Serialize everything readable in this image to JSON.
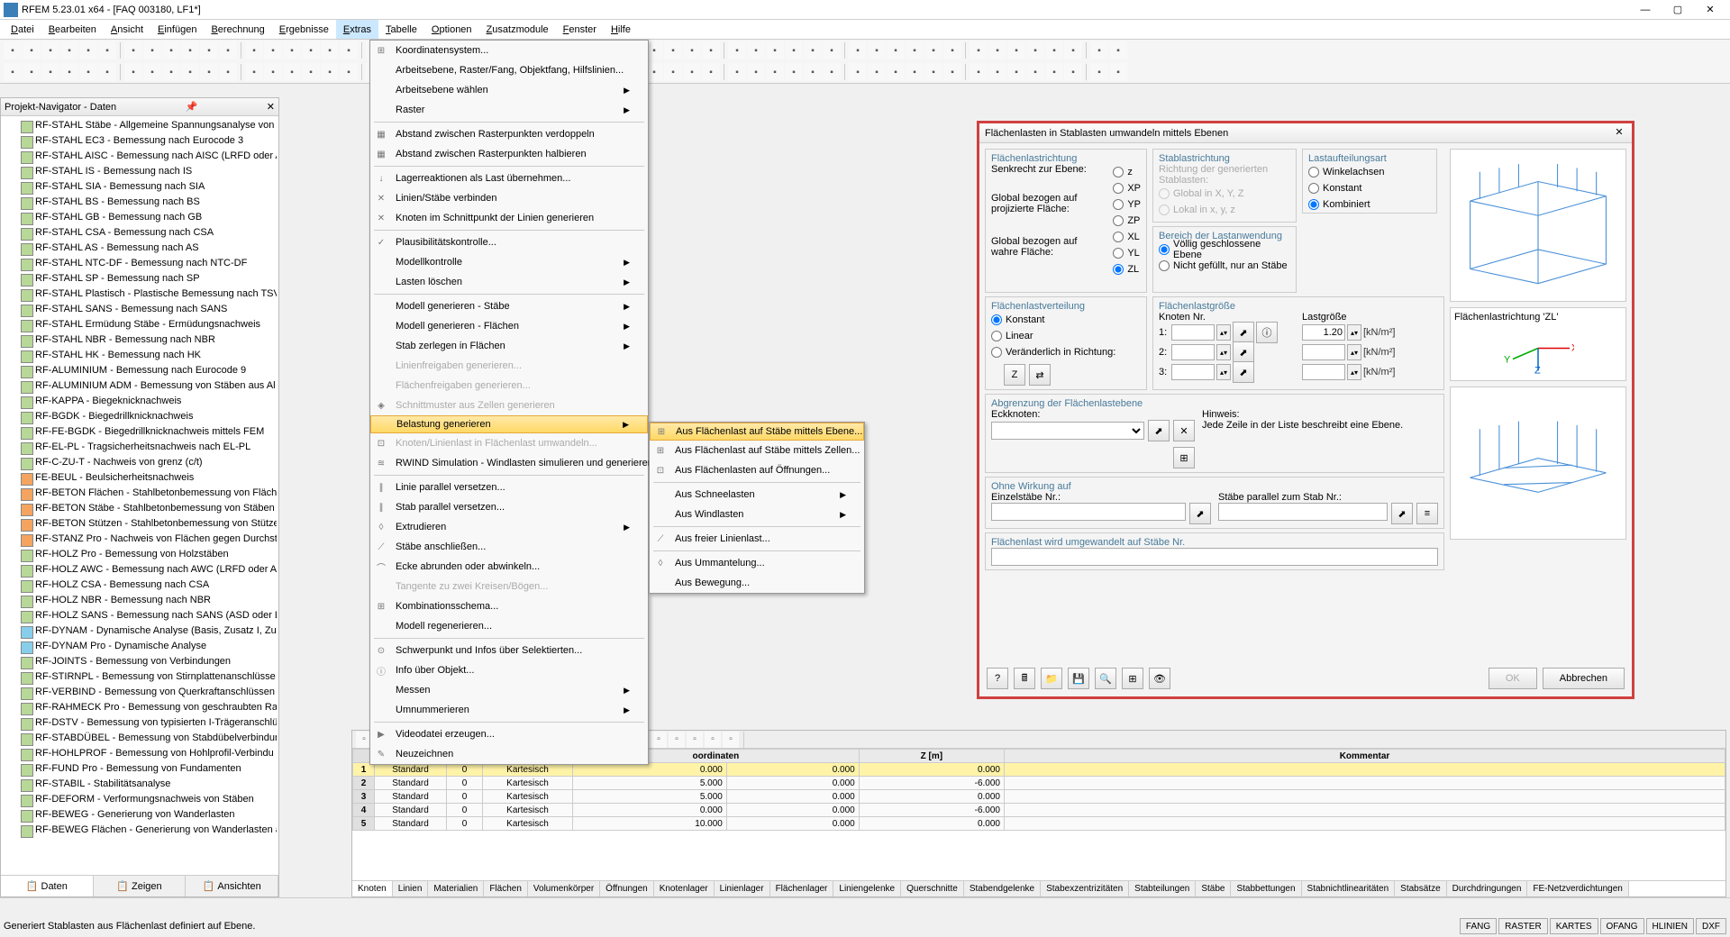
{
  "title": "RFEM 5.23.01 x64 - [FAQ 003180, LF1*]",
  "menubar": [
    "Datei",
    "Bearbeiten",
    "Ansicht",
    "Einfügen",
    "Berechnung",
    "Ergebnisse",
    "Extras",
    "Tabelle",
    "Optionen",
    "Zusatzmodule",
    "Fenster",
    "Hilfe"
  ],
  "menubar_active": 6,
  "navigator": {
    "title": "Projekt-Navigator - Daten",
    "items": [
      "RF-STAHL Stäbe - Allgemeine Spannungsanalyse von :",
      "RF-STAHL EC3 - Bemessung nach Eurocode 3",
      "RF-STAHL AISC - Bemessung nach AISC (LRFD oder A:",
      "RF-STAHL IS - Bemessung nach IS",
      "RF-STAHL SIA - Bemessung nach SIA",
      "RF-STAHL BS - Bemessung nach BS",
      "RF-STAHL GB - Bemessung nach GB",
      "RF-STAHL CSA - Bemessung nach CSA",
      "RF-STAHL AS - Bemessung nach AS",
      "RF-STAHL NTC-DF - Bemessung nach NTC-DF",
      "RF-STAHL SP - Bemessung nach SP",
      "RF-STAHL Plastisch - Plastische Bemessung nach TSV",
      "RF-STAHL SANS - Bemessung nach SANS",
      "RF-STAHL Ermüdung Stäbe - Ermüdungsnachweis",
      "RF-STAHL NBR - Bemessung nach NBR",
      "RF-STAHL HK - Bemessung nach HK",
      "RF-ALUMINIUM - Bemessung nach Eurocode 9",
      "RF-ALUMINIUM ADM - Bemessung von Stäben aus Al",
      "RF-KAPPA - Biegeknicknachweis",
      "RF-BGDK - Biegedrillknicknachweis",
      "RF-FE-BGDK - Biegedrillknicknachweis mittels FEM",
      "RF-EL-PL - Tragsicherheitsnachweis nach EL-PL",
      "RF-C-ZU-T - Nachweis von grenz (c/t)",
      "FE-BEUL - Beulsicherheitsnachweis",
      "RF-BETON Flächen - Stahlbetonbemessung von Fläche",
      "RF-BETON Stäbe - Stahlbetonbemessung von Stäben",
      "RF-BETON Stützen - Stahlbetonbemessung von Stütze",
      "RF-STANZ Pro - Nachweis von Flächen gegen Durchst",
      "RF-HOLZ Pro - Bemessung von Holzstäben",
      "RF-HOLZ AWC - Bemessung nach AWC (LRFD oder A:",
      "RF-HOLZ CSA - Bemessung nach CSA",
      "RF-HOLZ NBR - Bemessung nach NBR",
      "RF-HOLZ SANS - Bemessung nach SANS (ASD oder LS",
      "RF-DYNAM - Dynamische Analyse (Basis, Zusatz I, Zus",
      "RF-DYNAM Pro - Dynamische Analyse",
      "RF-JOINTS - Bemessung von Verbindungen",
      "RF-STIRNPL - Bemessung von Stirnplattenanschlüsse",
      "RF-VERBIND - Bemessung von Querkraftanschlüssen",
      "RF-RAHMECK Pro - Bemessung von geschraubten Ral",
      "RF-DSTV - Bemessung von typisierten I-Trägeranschlü",
      "RF-STABDÜBEL - Bemessung von Stabdübelverbindun",
      "RF-HOHLPROF - Bemessung von Hohlprofil-Verbindu",
      "RF-FUND Pro - Bemessung von Fundamenten",
      "RF-STABIL - Stabilitätsanalyse",
      "RF-DEFORM - Verformungsnachweis von Stäben",
      "RF-BEWEG - Generierung von Wanderlasten",
      "RF-BEWEG Flächen - Generierung von Wanderlasten a"
    ],
    "tabs": [
      "Daten",
      "Zeigen",
      "Ansichten"
    ]
  },
  "extras_menu": {
    "items": [
      {
        "t": "Koordinatensystem...",
        "i": "⊞"
      },
      {
        "t": "Arbeitsebene, Raster/Fang, Objektfang, Hilfslinien..."
      },
      {
        "t": "Arbeitsebene wählen",
        "arrow": true
      },
      {
        "t": "Raster",
        "arrow": true
      },
      {
        "sep": true
      },
      {
        "t": "Abstand zwischen Rasterpunkten verdoppeln",
        "i": "▦"
      },
      {
        "t": "Abstand zwischen Rasterpunkten halbieren",
        "i": "▦"
      },
      {
        "sep": true
      },
      {
        "t": "Lagerreaktionen als Last übernehmen...",
        "i": "↓"
      },
      {
        "t": "Linien/Stäbe verbinden",
        "i": "✕"
      },
      {
        "t": "Knoten im Schnittpunkt der Linien generieren",
        "i": "✕"
      },
      {
        "sep": true
      },
      {
        "t": "Plausibilitätskontrolle...",
        "i": "✓"
      },
      {
        "t": "Modellkontrolle",
        "arrow": true
      },
      {
        "t": "Lasten löschen",
        "arrow": true
      },
      {
        "sep": true
      },
      {
        "t": "Modell generieren - Stäbe",
        "arrow": true
      },
      {
        "t": "Modell generieren - Flächen",
        "arrow": true
      },
      {
        "t": "Stab zerlegen in Flächen",
        "arrow": true
      },
      {
        "t": "Linienfreigaben generieren...",
        "disabled": true
      },
      {
        "t": "Flächenfreigaben generieren...",
        "disabled": true
      },
      {
        "t": "Schnittmuster aus Zellen generieren",
        "disabled": true,
        "i": "◈"
      },
      {
        "t": "Belastung generieren",
        "arrow": true,
        "highlight": true
      },
      {
        "t": "Knoten/Linienlast in Flächenlast umwandeln...",
        "disabled": true,
        "i": "⊡"
      },
      {
        "t": "RWIND Simulation - Windlasten simulieren und generieren...",
        "i": "≋"
      },
      {
        "sep": true
      },
      {
        "t": "Linie parallel versetzen...",
        "i": "∥"
      },
      {
        "t": "Stab parallel versetzen...",
        "i": "∥"
      },
      {
        "t": "Extrudieren",
        "arrow": true,
        "i": "◊"
      },
      {
        "t": "Stäbe anschließen...",
        "i": "⟋"
      },
      {
        "t": "Ecke abrunden oder abwinkeln...",
        "i": "⌒"
      },
      {
        "t": "Tangente zu zwei Kreisen/Bögen...",
        "disabled": true
      },
      {
        "t": "Kombinationsschema...",
        "i": "⊞"
      },
      {
        "t": "Modell regenerieren..."
      },
      {
        "sep": true
      },
      {
        "t": "Schwerpunkt und Infos über Selektierten...",
        "i": "⊙"
      },
      {
        "t": "Info über Objekt...",
        "i": "ⓘ"
      },
      {
        "t": "Messen",
        "arrow": true
      },
      {
        "t": "Umnummerieren",
        "arrow": true
      },
      {
        "sep": true
      },
      {
        "t": "Videodatei erzeugen...",
        "i": "▶"
      },
      {
        "t": "Neuzeichnen",
        "i": "✎"
      }
    ]
  },
  "submenu": {
    "items": [
      {
        "t": "Aus Flächenlast auf Stäbe mittels Ebene...",
        "highlight": true,
        "i": "⊞"
      },
      {
        "t": "Aus Flächenlast auf Stäbe mittels Zellen...",
        "i": "⊞"
      },
      {
        "t": "Aus Flächenlasten auf Öffnungen...",
        "i": "⊡"
      },
      {
        "sep": true
      },
      {
        "t": "Aus Schneelasten",
        "arrow": true
      },
      {
        "t": "Aus Windlasten",
        "arrow": true
      },
      {
        "sep": true
      },
      {
        "t": "Aus freier Linienlast...",
        "i": "⟋"
      },
      {
        "sep": true
      },
      {
        "t": "Aus Ummantelung...",
        "i": "◊"
      },
      {
        "t": "Aus Bewegung..."
      }
    ]
  },
  "dialog": {
    "title": "Flächenlasten in Stablasten umwandeln mittels Ebenen",
    "groups": {
      "g1": "Flächenlastrichtung",
      "g1_opts": [
        "Senkrecht zur Ebene:",
        "Global bezogen auf projizierte Fläche:",
        "Global bezogen auf wahre Fläche:"
      ],
      "g1_r": [
        "z",
        "XP",
        "YP",
        "ZP",
        "XL",
        "YL",
        "ZL"
      ],
      "g2": "Stablastrichtung",
      "g2_sub": "Richtung der generierten Stablasten:",
      "g2_opts": [
        "Global in X, Y, Z",
        "Lokal in x, y, z"
      ],
      "g3": "Lastaufteilungsart",
      "g3_opts": [
        "Winkelachsen",
        "Konstant",
        "Kombiniert"
      ],
      "g4": "Bereich der Lastanwendung",
      "g4_opts": [
        "Völlig geschlossene Ebene",
        "Nicht gefüllt, nur an Stäbe"
      ],
      "g5": "Flächenlastverteilung",
      "g5_opts": [
        "Konstant",
        "Linear",
        "Veränderlich in Richtung:"
      ],
      "g6": "Flächenlastgröße",
      "g6_h1": "Knoten Nr.",
      "g6_h2": "Lastgröße",
      "g6_rows": [
        "1:",
        "2:",
        "3:"
      ],
      "g6_val": "1.20",
      "g6_unit": "[kN/m²]",
      "g7": "Abgrenzung der Flächenlastebene",
      "g7_l": "Eckknoten:",
      "g7_hint_t": "Hinweis:",
      "g7_hint": "Jede Zeile in der Liste beschreibt eine Ebene.",
      "g8": "Ohne Wirkung auf",
      "g8_l1": "Einzelstäbe Nr.:",
      "g8_l2": "Stäbe parallel zum Stab Nr.:",
      "g9": "Flächenlast wird umgewandelt auf Stäbe Nr."
    },
    "preview_label": "Flächenlastrichtung 'ZL'",
    "axes": {
      "x": "X",
      "y": "Y",
      "z": "Z"
    },
    "ok": "OK",
    "cancel": "Abbrechen"
  },
  "table": {
    "headers_top": [
      "",
      "",
      "",
      "",
      "oordinaten",
      ""
    ],
    "headers": [
      "",
      "[m]",
      "",
      "[m]",
      "[m]",
      "Kommentar"
    ],
    "group_header": "Kommentar",
    "rows": [
      [
        "1",
        "Standard",
        "0",
        "Kartesisch",
        "0.000",
        "0.000",
        "0.000"
      ],
      [
        "2",
        "Standard",
        "0",
        "Kartesisch",
        "5.000",
        "0.000",
        "-6.000"
      ],
      [
        "3",
        "Standard",
        "0",
        "Kartesisch",
        "5.000",
        "0.000",
        "0.000"
      ],
      [
        "4",
        "Standard",
        "0",
        "Kartesisch",
        "0.000",
        "0.000",
        "-6.000"
      ],
      [
        "5",
        "Standard",
        "0",
        "Kartesisch",
        "10.000",
        "0.000",
        "0.000"
      ]
    ],
    "tabs": [
      "Knoten",
      "Linien",
      "Materialien",
      "Flächen",
      "Volumenkörper",
      "Öffnungen",
      "Knotenlager",
      "Linienlager",
      "Flächenlager",
      "Liniengelenke",
      "Querschnitte",
      "Stabendgelenke",
      "Stabexzentrizitäten",
      "Stabteilungen",
      "Stäbe",
      "Stabbettungen",
      "Stabnichtlinearitäten",
      "Stabsätze",
      "Durchdringungen",
      "FE-Netzverdichtungen"
    ]
  },
  "status": {
    "text": "Generiert Stablasten aus Flächenlast definiert auf Ebene.",
    "btns": [
      "FANG",
      "RASTER",
      "KARTES",
      "OFANG",
      "HLINIEN",
      "DXF"
    ]
  }
}
